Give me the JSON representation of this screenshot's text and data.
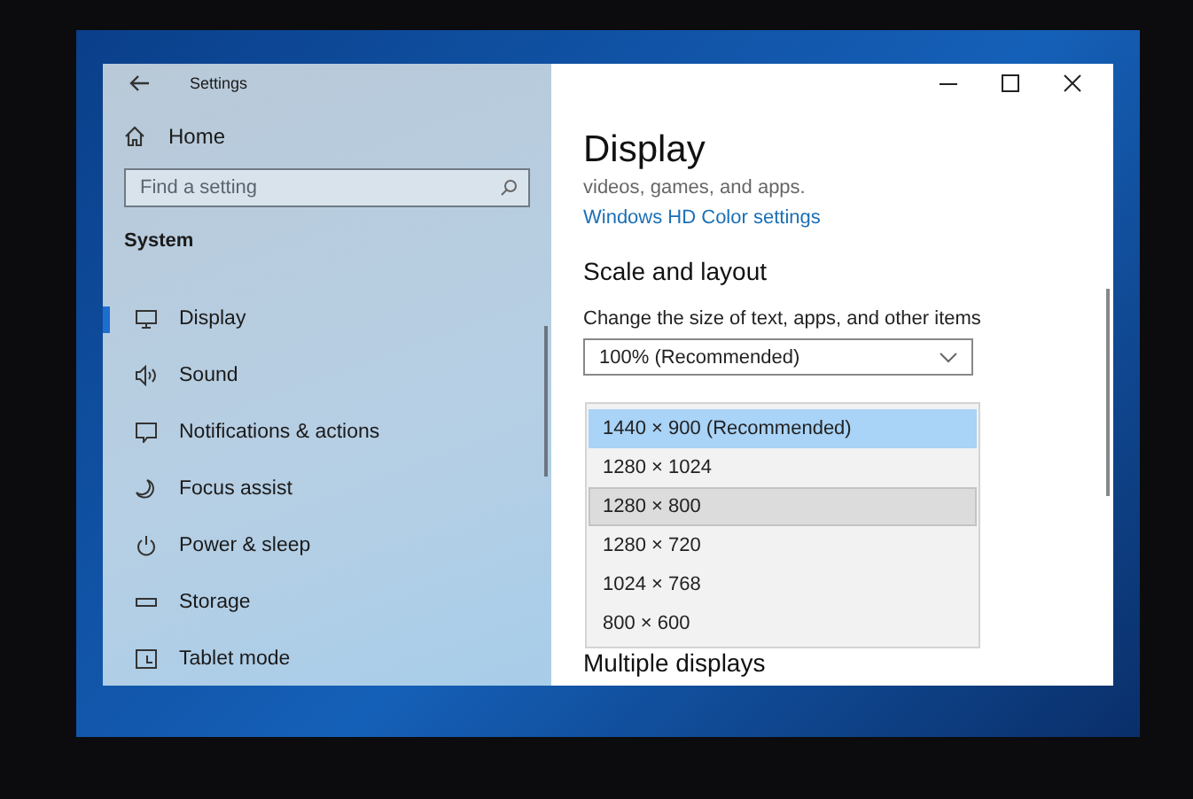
{
  "window": {
    "title": "Settings"
  },
  "sidebar": {
    "home": "Home",
    "search": {
      "placeholder": "Find a setting"
    },
    "section": "System",
    "items": [
      {
        "label": "Display",
        "kind": "monitor",
        "selected": true
      },
      {
        "label": "Sound",
        "kind": "speaker",
        "selected": false
      },
      {
        "label": "Notifications & actions",
        "kind": "message",
        "selected": false
      },
      {
        "label": "Focus assist",
        "kind": "moon",
        "selected": false
      },
      {
        "label": "Power & sleep",
        "kind": "power",
        "selected": false
      },
      {
        "label": "Storage",
        "kind": "drive",
        "selected": false
      },
      {
        "label": "Tablet mode",
        "kind": "tablet",
        "selected": false
      }
    ]
  },
  "content": {
    "title": "Display",
    "text": "videos, games, and apps.",
    "link": "Windows HD Color settings",
    "heading": "Scale and layout",
    "scale_label": "Change the size of text, apps, and other items",
    "scale_value": "100% (Recommended)",
    "resolution_options": [
      {
        "label": "1440 × 900 (Recommended)",
        "selected": true,
        "hovered": false
      },
      {
        "label": "1280 × 1024",
        "selected": false,
        "hovered": false
      },
      {
        "label": "1280 × 800",
        "selected": false,
        "hovered": true
      },
      {
        "label": "1280 × 720",
        "selected": false,
        "hovered": false
      },
      {
        "label": "1024 × 768",
        "selected": false,
        "hovered": false
      },
      {
        "label": "800 × 600",
        "selected": false,
        "hovered": false
      }
    ],
    "heading_2": "Multiple displays"
  }
}
